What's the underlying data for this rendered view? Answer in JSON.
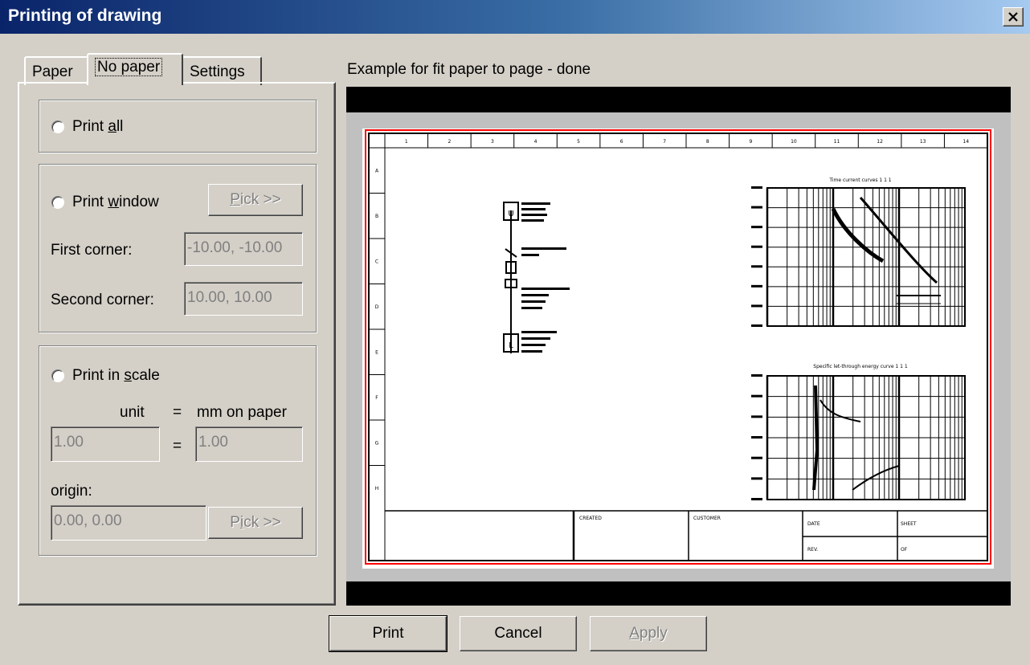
{
  "window": {
    "title": "Printing of drawing",
    "close_glyph": "×"
  },
  "tabs": [
    {
      "label": "Paper",
      "active": false
    },
    {
      "label": "No paper",
      "active": true
    },
    {
      "label": "Settings",
      "active": false
    }
  ],
  "print_all": {
    "prefix": "Print ",
    "mnemonic": "a",
    "suffix": "ll"
  },
  "print_window": {
    "prefix": "Print ",
    "mnemonic": "w",
    "suffix": "indow",
    "pick_mnemonic": "P",
    "pick_suffix": "ick >>",
    "first_corner_label": "First corner:",
    "first_corner_value": "-10.00, -10.00",
    "second_corner_label": "Second corner:",
    "second_corner_value": "10.00, 10.00"
  },
  "print_scale": {
    "prefix": "Print in ",
    "mnemonic": "s",
    "suffix": "cale",
    "unit_label": "unit",
    "equals": "=",
    "mm_label": "mm on paper",
    "unit_value": "1.00",
    "mm_value": "1.00",
    "origin_label": "origin:",
    "origin_value": "0.00, 0.00",
    "pick_prefix": "P",
    "pick_mnemonic": "i",
    "pick_suffix": "ck >>"
  },
  "preview": {
    "caption": "Example for fit paper to page - done",
    "border_color": "#ff0000",
    "ruler_numbers": [
      "1",
      "2",
      "3",
      "4",
      "5",
      "6",
      "7",
      "8",
      "9",
      "10",
      "11",
      "12",
      "13",
      "14"
    ],
    "ruler_letters": [
      "A",
      "B",
      "C",
      "D",
      "E",
      "F",
      "G",
      "H"
    ],
    "diagram_symbols": [
      "U",
      "L"
    ],
    "chart1_title": "Time current curves 1 1 1",
    "chart2_title": "Specific let-through energy curve 1 1 1",
    "title_block": [
      "CREATED",
      "CUSTOMER",
      "DATE",
      "SHEET",
      "REV.",
      "OF"
    ]
  },
  "buttons": {
    "print": "Print",
    "cancel": "Cancel",
    "apply_mnemonic": "A",
    "apply_suffix": "pply"
  },
  "colors": {
    "title_start": "#0a246a",
    "title_end": "#a6caf0",
    "face": "#d4d0c8"
  }
}
